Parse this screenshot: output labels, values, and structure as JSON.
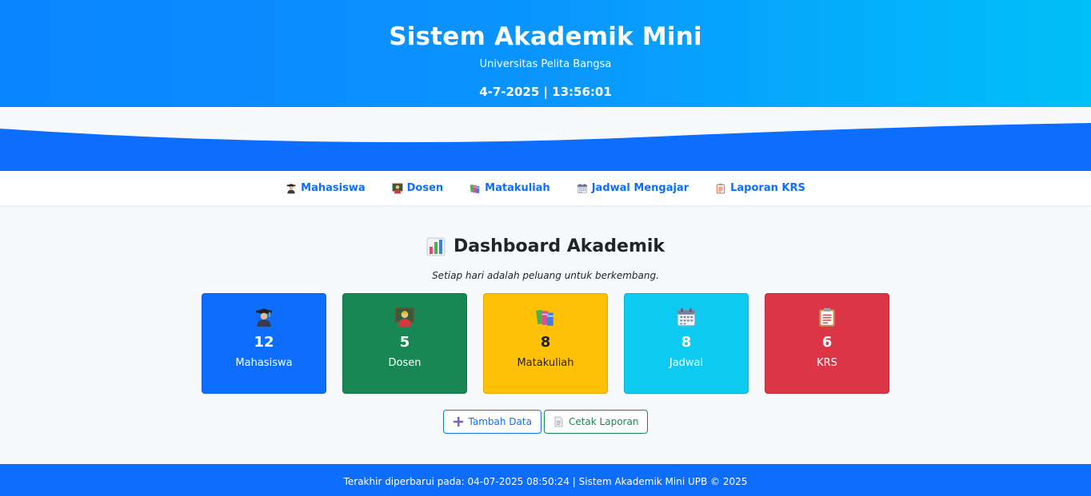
{
  "header": {
    "title": "Sistem Akademik Mini",
    "subtitle": "Universitas Pelita Bangsa",
    "clock": "4-7-2025 | 13:56:01"
  },
  "nav": {
    "items": [
      {
        "label": "Mahasiswa",
        "icon": "student-icon"
      },
      {
        "label": "Dosen",
        "icon": "teacher-icon"
      },
      {
        "label": "Matakuliah",
        "icon": "books-icon"
      },
      {
        "label": "Jadwal Mengajar",
        "icon": "calendar-icon"
      },
      {
        "label": "Laporan KRS",
        "icon": "clipboard-icon"
      }
    ]
  },
  "dashboard": {
    "title": "Dashboard Akademik",
    "title_icon": "bar-chart-icon",
    "tagline": "Setiap hari adalah peluang untuk berkembang."
  },
  "cards": [
    {
      "count": "12",
      "label": "Mahasiswa",
      "icon": "student-icon",
      "color": "#0d6efd",
      "text_color": "#ffffff"
    },
    {
      "count": "5",
      "label": "Dosen",
      "icon": "teacher-icon",
      "color": "#198754",
      "text_color": "#ffffff"
    },
    {
      "count": "8",
      "label": "Matakuliah",
      "icon": "books-icon",
      "color": "#ffc107",
      "text_color": "#212529"
    },
    {
      "count": "8",
      "label": "Jadwal",
      "icon": "calendar-icon",
      "color": "#0dcaf0",
      "text_color": "#ffffff"
    },
    {
      "count": "6",
      "label": "KRS",
      "icon": "clipboard-icon",
      "color": "#dc3545",
      "text_color": "#ffffff"
    }
  ],
  "actions": {
    "add_label": "Tambah Data",
    "print_label": "Cetak Laporan"
  },
  "footer": {
    "text": "Terakhir diperbarui pada: 04-07-2025 08:50:24 | Sistem Akademik Mini UPB © 2025"
  },
  "colors": {
    "primary": "#0d6efd",
    "success": "#198754",
    "warning": "#ffc107",
    "info": "#0dcaf0",
    "danger": "#dc3545"
  }
}
